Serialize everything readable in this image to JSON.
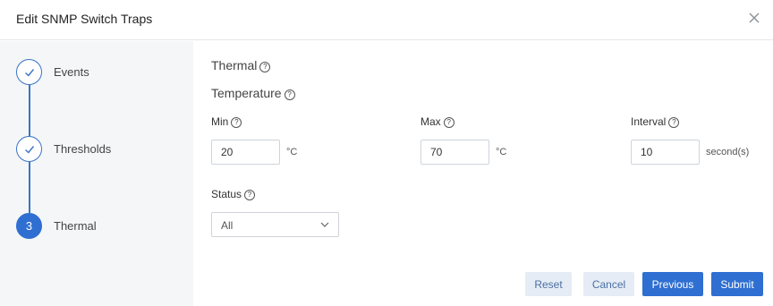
{
  "dialog": {
    "title": "Edit SNMP Switch Traps"
  },
  "steps": [
    {
      "label": "Events",
      "state": "done"
    },
    {
      "label": "Thresholds",
      "state": "done"
    },
    {
      "label": "Thermal",
      "state": "active",
      "number": "3"
    }
  ],
  "main": {
    "section": "Thermal",
    "subsection": "Temperature",
    "min": {
      "label": "Min",
      "value": "20",
      "unit": "°C"
    },
    "max": {
      "label": "Max",
      "value": "70",
      "unit": "°C"
    },
    "interval": {
      "label": "Interval",
      "value": "10",
      "unit": "second(s)"
    },
    "status": {
      "label": "Status",
      "value": "All"
    }
  },
  "buttons": {
    "reset": "Reset",
    "cancel": "Cancel",
    "previous": "Previous",
    "submit": "Submit"
  },
  "colors": {
    "accent": "#2f6fd1",
    "sidebar_bg": "#f5f6f8",
    "light_button_bg": "#e6ecf5"
  }
}
